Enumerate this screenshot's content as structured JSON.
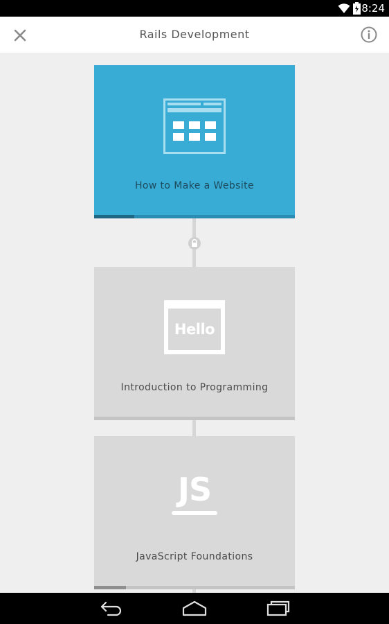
{
  "status_bar": {
    "time": "8:24"
  },
  "header": {
    "title": "Rails Development"
  },
  "courses": [
    {
      "title": "How to Make a Website",
      "state": "active",
      "progress": 0.2,
      "color": "#38acd5"
    },
    {
      "title": "Introduction to Programming",
      "state": "locked",
      "progress": 0.0,
      "icon_text": "Hello"
    },
    {
      "title": "JavaScript Foundations",
      "state": "locked",
      "progress": 0.16,
      "icon_text": "JS"
    }
  ],
  "colors": {
    "accent": "#38acd5",
    "locked_card": "#d9d9d9",
    "background": "#efefef"
  },
  "icons": {
    "close": "close-icon",
    "info": "info-icon",
    "lock": "lock-icon",
    "back": "back-icon",
    "home": "home-icon",
    "recents": "recents-icon"
  }
}
